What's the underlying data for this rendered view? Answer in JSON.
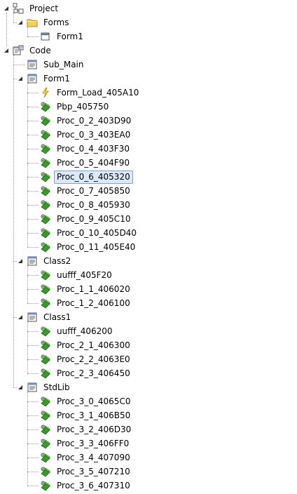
{
  "nodes": [
    {
      "id": "project",
      "label": "Project",
      "level": 0,
      "icon": "project-icon",
      "expandable": true
    },
    {
      "id": "forms",
      "label": "Forms",
      "level": 1,
      "icon": "folder-icon",
      "expandable": true
    },
    {
      "id": "form1-form",
      "label": "Form1",
      "level": 2,
      "icon": "form-icon",
      "expandable": false
    },
    {
      "id": "code",
      "label": "Code",
      "level": 0,
      "icon": "code-icon",
      "expandable": true
    },
    {
      "id": "sub-main",
      "label": "Sub_Main",
      "level": 1,
      "icon": "module-icon",
      "expandable": false
    },
    {
      "id": "form1-module",
      "label": "Form1",
      "level": 1,
      "icon": "module-icon",
      "expandable": true
    },
    {
      "id": "form-load",
      "label": "Form_Load_405A10",
      "level": 2,
      "icon": "event-icon",
      "expandable": false
    },
    {
      "id": "pbp",
      "label": "Pbp_405750",
      "level": 2,
      "icon": "procedure-icon",
      "expandable": false
    },
    {
      "id": "p0-2",
      "label": "Proc_0_2_403D90",
      "level": 2,
      "icon": "procedure-icon",
      "expandable": false
    },
    {
      "id": "p0-3",
      "label": "Proc_0_3_403EA0",
      "level": 2,
      "icon": "procedure-icon",
      "expandable": false
    },
    {
      "id": "p0-4",
      "label": "Proc_0_4_403F30",
      "level": 2,
      "icon": "procedure-icon",
      "expandable": false
    },
    {
      "id": "p0-5",
      "label": "Proc_0_5_404F90",
      "level": 2,
      "icon": "procedure-icon",
      "expandable": false
    },
    {
      "id": "p0-6",
      "label": "Proc_0_6_405320",
      "level": 2,
      "icon": "procedure-icon",
      "expandable": false,
      "selected": true
    },
    {
      "id": "p0-7",
      "label": "Proc_0_7_405850",
      "level": 2,
      "icon": "procedure-icon",
      "expandable": false
    },
    {
      "id": "p0-8",
      "label": "Proc_0_8_405930",
      "level": 2,
      "icon": "procedure-icon",
      "expandable": false
    },
    {
      "id": "p0-9",
      "label": "Proc_0_9_405C10",
      "level": 2,
      "icon": "procedure-icon",
      "expandable": false
    },
    {
      "id": "p0-10",
      "label": "Proc_0_10_405D40",
      "level": 2,
      "icon": "procedure-icon",
      "expandable": false
    },
    {
      "id": "p0-11",
      "label": "Proc_0_11_405E40",
      "level": 2,
      "icon": "procedure-icon",
      "expandable": false
    },
    {
      "id": "class2",
      "label": "Class2",
      "level": 1,
      "icon": "module-icon",
      "expandable": true
    },
    {
      "id": "uufff-405f20",
      "label": "uufff_405F20",
      "level": 2,
      "icon": "procedure-icon",
      "expandable": false
    },
    {
      "id": "p1-1",
      "label": "Proc_1_1_406020",
      "level": 2,
      "icon": "procedure-icon",
      "expandable": false
    },
    {
      "id": "p1-2",
      "label": "Proc_1_2_406100",
      "level": 2,
      "icon": "procedure-icon",
      "expandable": false
    },
    {
      "id": "class1",
      "label": "Class1",
      "level": 1,
      "icon": "module-icon",
      "expandable": true
    },
    {
      "id": "uufff-406200",
      "label": "uufff_406200",
      "level": 2,
      "icon": "procedure-icon",
      "expandable": false
    },
    {
      "id": "p2-1",
      "label": "Proc_2_1_406300",
      "level": 2,
      "icon": "procedure-icon",
      "expandable": false
    },
    {
      "id": "p2-2",
      "label": "Proc_2_2_4063E0",
      "level": 2,
      "icon": "procedure-icon",
      "expandable": false
    },
    {
      "id": "p2-3",
      "label": "Proc_2_3_406450",
      "level": 2,
      "icon": "procedure-icon",
      "expandable": false
    },
    {
      "id": "stdlib",
      "label": "StdLib",
      "level": 1,
      "icon": "module-icon",
      "expandable": true
    },
    {
      "id": "p3-0",
      "label": "Proc_3_0_4065C0",
      "level": 2,
      "icon": "procedure-icon",
      "expandable": false
    },
    {
      "id": "p3-1",
      "label": "Proc_3_1_406B50",
      "level": 2,
      "icon": "procedure-icon",
      "expandable": false
    },
    {
      "id": "p3-2",
      "label": "Proc_3_2_406D30",
      "level": 2,
      "icon": "procedure-icon",
      "expandable": false
    },
    {
      "id": "p3-3",
      "label": "Proc_3_3_406FF0",
      "level": 2,
      "icon": "procedure-icon",
      "expandable": false
    },
    {
      "id": "p3-4",
      "label": "Proc_3_4_407090",
      "level": 2,
      "icon": "procedure-icon",
      "expandable": false
    },
    {
      "id": "p3-5",
      "label": "Proc_3_5_407210",
      "level": 2,
      "icon": "procedure-icon",
      "expandable": false
    },
    {
      "id": "p3-6",
      "label": "Proc_3_6_407310",
      "level": 2,
      "icon": "procedure-icon",
      "expandable": false
    }
  ],
  "colors": {
    "selection_bg": "#dce8fb",
    "selection_border": "#7da2ce",
    "procedure_green": "#3a9a2a",
    "folder_yellow": "#f3cf5a"
  }
}
